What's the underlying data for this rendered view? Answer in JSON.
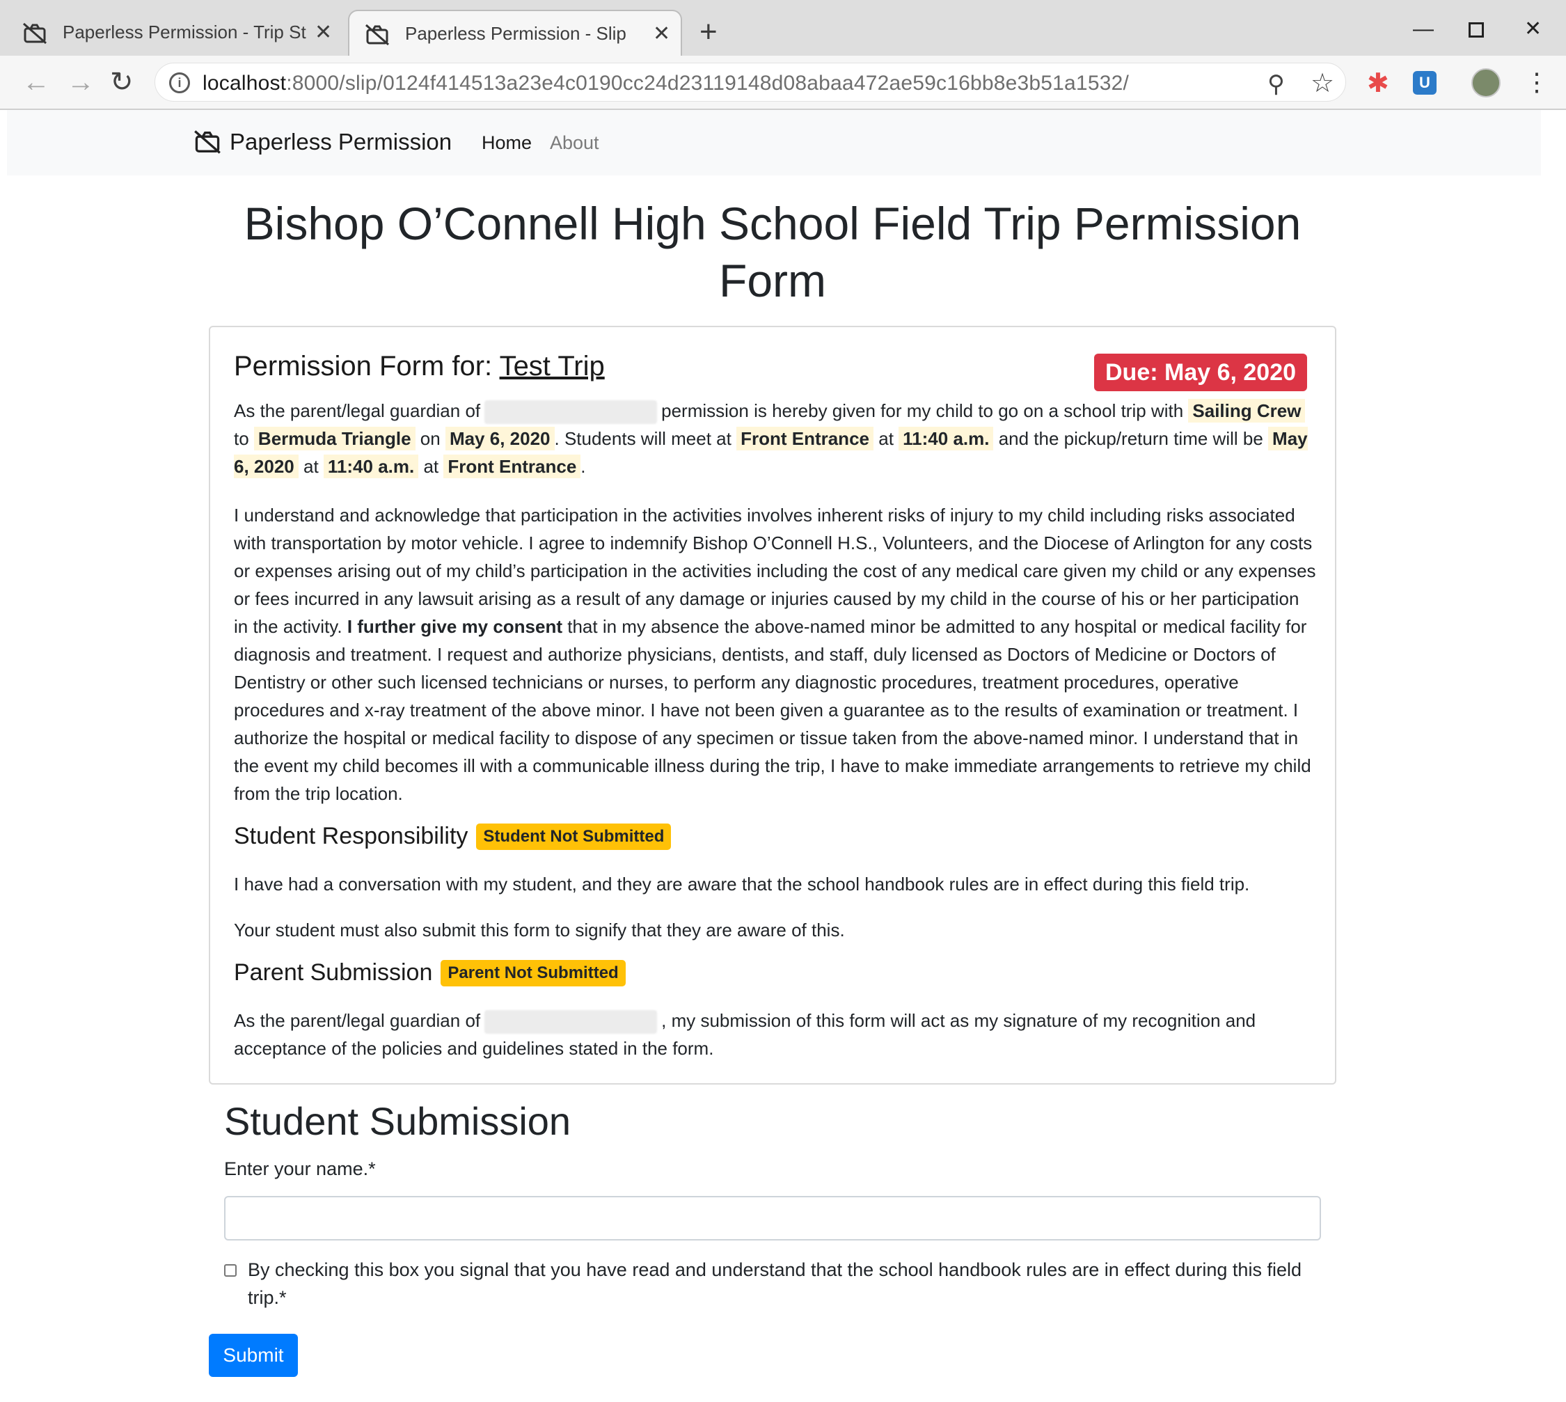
{
  "browser": {
    "tabs": [
      {
        "title": "Paperless Permission - Trip St"
      },
      {
        "title": "Paperless Permission - Slip"
      }
    ],
    "url_host": "localhost",
    "url_rest": ":8000/slip/0124f414513a23e4c0190cc24d23119148d08abaa472ae59c16bb8e3b51a1532/"
  },
  "navbar": {
    "brand": "Paperless Permission",
    "home": "Home",
    "about": "About"
  },
  "page_title": "Bishop O’Connell High School Field Trip Permission Form",
  "card": {
    "heading_prefix": "Permission Form for:",
    "trip_name": "Test Trip",
    "due": "Due: May 6, 2020",
    "intro": {
      "t1": "As the parent/legal guardian of",
      "t2": "permission is hereby given for my child to go on a school trip with",
      "group": "Sailing Crew",
      "t3": "to",
      "destination": "Bermuda Triangle",
      "t4": "on",
      "trip_date": "May 6, 2020",
      "t5": ". Students will meet at",
      "meet_location": "Front Entrance",
      "t6": "at",
      "meet_time": "11:40 a.m.",
      "t7": "and the pickup/return time will be",
      "return_date": "May 6, 2020",
      "t8": "at",
      "return_time": "11:40 a.m.",
      "t9": "at",
      "return_location": "Front Entrance",
      "t10": "."
    },
    "legal_1": "I understand and acknowledge that participation in the activities involves inherent risks of injury to my child including risks associated with transportation by motor vehicle. I agree to indemnify Bishop O’Connell H.S., Volunteers, and the Diocese of Arlington for any costs or expenses arising out of my child’s participation in the activities including the cost of any medical care given my child or any expenses or fees incurred in any lawsuit arising as a result of any damage or injuries caused by my child in the course of his or her participation in the activity.",
    "legal_bold": "I further give my consent",
    "legal_2": "that in my absence the above-named minor be admitted to any hospital or medical facility for diagnosis and treatment. I request and authorize physicians, dentists, and staff, duly licensed as Doctors of Medicine or Doctors of Dentistry or other such licensed technicians or nurses, to perform any diagnostic procedures, treatment procedures, operative procedures and x-ray treatment of the above minor. I have not been given a guarantee as to the results of examination or treatment. I authorize the hospital or medical facility to dispose of any specimen or tissue taken from the above-named minor. I understand that in the event my child becomes ill with a communicable illness during the trip, I have to make immediate arrangements to retrieve my child from the trip location.",
    "student_resp": {
      "heading": "Student Responsibility",
      "badge": "Student Not Submitted",
      "p1": "I have had a conversation with my student, and they are aware that the school handbook rules are in effect during this field trip.",
      "p2": "Your student must also submit this form to signify that they are aware of this."
    },
    "parent_sub": {
      "heading": "Parent Submission",
      "badge": "Parent Not Submitted",
      "t1": "As the parent/legal guardian of",
      "t2": ", my submission of this form will act as my signature of my recognition and acceptance of the policies and guidelines stated in the form."
    }
  },
  "student_submission": {
    "title": "Student Submission",
    "name_label": "Enter your name.*",
    "name_value": "",
    "checkbox_label": "By checking this box you signal that you have read and understand that the school handbook rules are in effect during this field trip.*",
    "submit": "Submit"
  },
  "colors": {
    "danger": "#dc3545",
    "warning": "#ffc107",
    "primary": "#007bff",
    "highlight": "#fff6d9"
  },
  "icons": [
    "no-camera-icon",
    "back-icon",
    "forward-icon",
    "reload-icon",
    "info-icon",
    "zoom-icon",
    "star-icon",
    "extension-icon",
    "bitwarden-icon",
    "menu-icon",
    "close-icon",
    "plus-icon"
  ]
}
